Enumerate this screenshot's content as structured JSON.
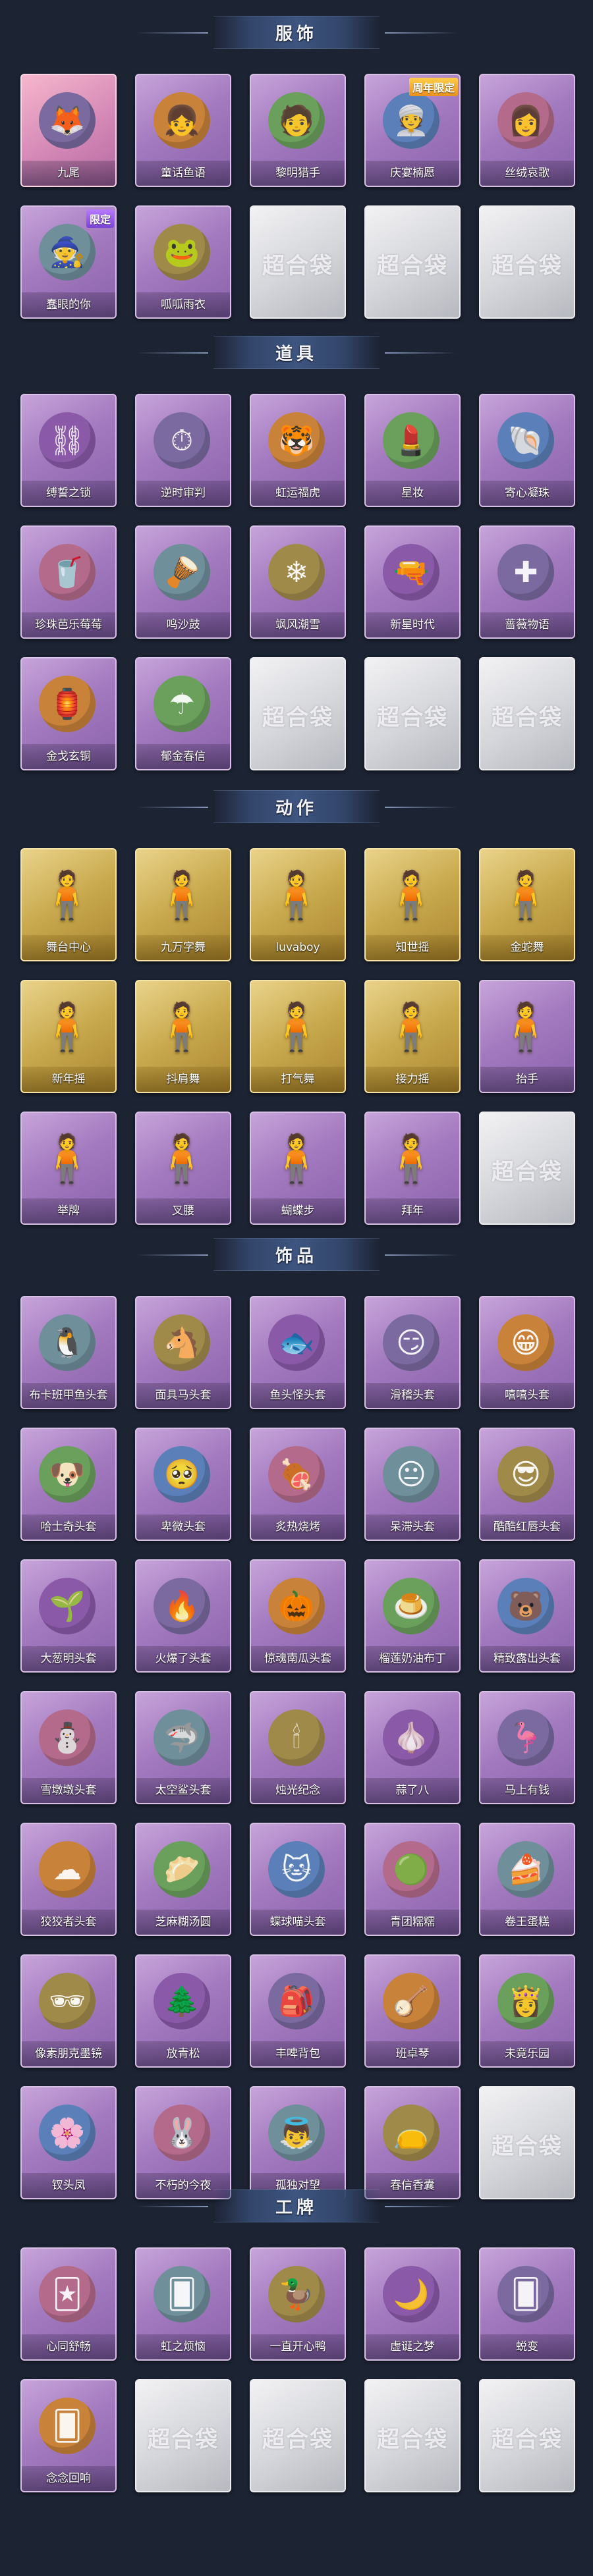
{
  "colors": {
    "background": "#1c2333",
    "banner": "#3d5580",
    "purple": "#a37abf",
    "gold": "#c8a84c",
    "empty": "#d4d5da"
  },
  "empty_watermark": "超合袋",
  "sections": [
    {
      "title": "服饰",
      "items": [
        {
          "label": "九尾",
          "rarity": "pink",
          "badge": "",
          "icon": "fox-costume-icon"
        },
        {
          "label": "童话鱼语",
          "rarity": "purple",
          "badge": "",
          "icon": "girl-portrait-icon"
        },
        {
          "label": "黎明猎手",
          "rarity": "purple",
          "badge": "",
          "icon": "hunter-portrait-icon"
        },
        {
          "label": "庆宴楠愿",
          "rarity": "purple",
          "badge": "周年限定",
          "icon": "party-portrait-icon"
        },
        {
          "label": "丝绒哀歌",
          "rarity": "purple",
          "badge": "",
          "icon": "velvet-portrait-icon"
        },
        {
          "label": "蠢眼的你",
          "rarity": "purple",
          "badge": "限定",
          "icon": "witch-portrait-icon"
        },
        {
          "label": "呱呱雨衣",
          "rarity": "purple",
          "badge": "",
          "icon": "frog-raincoat-icon"
        },
        {
          "label": "",
          "rarity": "empty",
          "badge": "",
          "icon": ""
        },
        {
          "label": "",
          "rarity": "empty",
          "badge": "",
          "icon": ""
        },
        {
          "label": "",
          "rarity": "empty",
          "badge": "",
          "icon": ""
        }
      ]
    },
    {
      "title": "道具",
      "items": [
        {
          "label": "缚誓之锁",
          "rarity": "purple",
          "badge": "",
          "icon": "chain-icon"
        },
        {
          "label": "逆时审判",
          "rarity": "purple",
          "badge": "",
          "icon": "clock-icon"
        },
        {
          "label": "虹运福虎",
          "rarity": "purple",
          "badge": "",
          "icon": "tiger-icon"
        },
        {
          "label": "星妆",
          "rarity": "purple",
          "badge": "",
          "icon": "cosmetic-icon"
        },
        {
          "label": "寄心凝珠",
          "rarity": "purple",
          "badge": "",
          "icon": "pearl-icon"
        },
        {
          "label": "珍珠芭乐莓莓",
          "rarity": "purple",
          "badge": "",
          "icon": "drink-icon"
        },
        {
          "label": "鸣沙鼓",
          "rarity": "purple",
          "badge": "",
          "icon": "drum-icon"
        },
        {
          "label": "飒风潮雪",
          "rarity": "purple",
          "badge": "",
          "icon": "ice-icon"
        },
        {
          "label": "新星时代",
          "rarity": "purple",
          "badge": "",
          "icon": "pistol-icon"
        },
        {
          "label": "蔷薇物语",
          "rarity": "purple",
          "badge": "",
          "icon": "medkit-icon"
        },
        {
          "label": "金戈玄铜",
          "rarity": "purple",
          "badge": "",
          "icon": "lantern-icon"
        },
        {
          "label": "郁金春信",
          "rarity": "purple",
          "badge": "",
          "icon": "umbrella-icon"
        },
        {
          "label": "",
          "rarity": "empty",
          "badge": "",
          "icon": ""
        },
        {
          "label": "",
          "rarity": "empty",
          "badge": "",
          "icon": ""
        },
        {
          "label": "",
          "rarity": "empty",
          "badge": "",
          "icon": ""
        }
      ]
    },
    {
      "title": "动作",
      "items": [
        {
          "label": "舞台中心",
          "rarity": "gold",
          "badge": "",
          "icon": "pose-icon"
        },
        {
          "label": "九万字舞",
          "rarity": "gold",
          "badge": "",
          "icon": "pose-icon"
        },
        {
          "label": "luvaboy",
          "rarity": "gold",
          "badge": "",
          "icon": "pose-icon"
        },
        {
          "label": "知世摇",
          "rarity": "gold",
          "badge": "",
          "icon": "pose-icon"
        },
        {
          "label": "金蛇舞",
          "rarity": "gold",
          "badge": "",
          "icon": "pose-icon"
        },
        {
          "label": "新年摇",
          "rarity": "gold",
          "badge": "",
          "icon": "pose-icon"
        },
        {
          "label": "抖肩舞",
          "rarity": "gold",
          "badge": "",
          "icon": "pose-icon"
        },
        {
          "label": "打气舞",
          "rarity": "gold",
          "badge": "",
          "icon": "pose-icon"
        },
        {
          "label": "接力摇",
          "rarity": "gold",
          "badge": "",
          "icon": "pose-icon"
        },
        {
          "label": "抬手",
          "rarity": "purple",
          "badge": "",
          "icon": "pose-icon"
        },
        {
          "label": "举牌",
          "rarity": "purple",
          "badge": "",
          "icon": "pose-icon"
        },
        {
          "label": "叉腰",
          "rarity": "purple",
          "badge": "",
          "icon": "pose-icon"
        },
        {
          "label": "蝴蝶步",
          "rarity": "purple",
          "badge": "",
          "icon": "pose-icon"
        },
        {
          "label": "拜年",
          "rarity": "purple",
          "badge": "",
          "icon": "pose-icon"
        },
        {
          "label": "",
          "rarity": "empty",
          "badge": "",
          "icon": ""
        }
      ]
    },
    {
      "title": "饰品",
      "items": [
        {
          "label": "布卡班甲鱼头套",
          "rarity": "purple",
          "badge": "",
          "icon": "seal-head-icon"
        },
        {
          "label": "面具马头套",
          "rarity": "purple",
          "badge": "",
          "icon": "horse-head-icon"
        },
        {
          "label": "鱼头怪头套",
          "rarity": "purple",
          "badge": "",
          "icon": "fish-head-icon"
        },
        {
          "label": "滑稽头套",
          "rarity": "purple",
          "badge": "",
          "icon": "smirk-head-icon"
        },
        {
          "label": "嘻嘻头套",
          "rarity": "purple",
          "badge": "",
          "icon": "grin-head-icon"
        },
        {
          "label": "哈士奇头套",
          "rarity": "purple",
          "badge": "",
          "icon": "dog-head-icon"
        },
        {
          "label": "卑微头套",
          "rarity": "purple",
          "badge": "",
          "icon": "sad-head-icon"
        },
        {
          "label": "炙热烧烤",
          "rarity": "purple",
          "badge": "",
          "icon": "bbq-head-icon"
        },
        {
          "label": "呆滞头套",
          "rarity": "purple",
          "badge": "",
          "icon": "dull-head-icon"
        },
        {
          "label": "酷酷红唇头套",
          "rarity": "purple",
          "badge": "",
          "icon": "cool-head-icon"
        },
        {
          "label": "大葱明头套",
          "rarity": "purple",
          "badge": "",
          "icon": "scallion-head-icon"
        },
        {
          "label": "火爆了头套",
          "rarity": "purple",
          "badge": "",
          "icon": "fire-head-icon"
        },
        {
          "label": "惊魂南瓜头套",
          "rarity": "purple",
          "badge": "",
          "icon": "pumpkin-head-icon"
        },
        {
          "label": "榴莲奶油布丁",
          "rarity": "purple",
          "badge": "",
          "icon": "pudding-head-icon"
        },
        {
          "label": "精致露出头套",
          "rarity": "purple",
          "badge": "",
          "icon": "pink-bear-head-icon"
        },
        {
          "label": "雪墩墩头套",
          "rarity": "purple",
          "badge": "",
          "icon": "snowman-head-icon"
        },
        {
          "label": "太空鲨头套",
          "rarity": "purple",
          "badge": "",
          "icon": "shark-head-icon"
        },
        {
          "label": "烛光纪念",
          "rarity": "purple",
          "badge": "",
          "icon": "candle-head-icon"
        },
        {
          "label": "蒜了八",
          "rarity": "purple",
          "badge": "",
          "icon": "garlic-head-icon"
        },
        {
          "label": "马上有钱",
          "rarity": "purple",
          "badge": "",
          "icon": "flamingo-head-icon"
        },
        {
          "label": "狡狡者头套",
          "rarity": "purple",
          "badge": "",
          "icon": "cloud-head-icon"
        },
        {
          "label": "芝麻糊汤圆",
          "rarity": "purple",
          "badge": "",
          "icon": "dumpling-head-icon"
        },
        {
          "label": "蝶球喵头套",
          "rarity": "purple",
          "badge": "",
          "icon": "cat-head-icon"
        },
        {
          "label": "青团糯糯",
          "rarity": "purple",
          "badge": "",
          "icon": "green-dumpling-head-icon"
        },
        {
          "label": "卷王蛋糕",
          "rarity": "purple",
          "badge": "",
          "icon": "roll-cake-head-icon"
        },
        {
          "label": "像素朋克墨镜",
          "rarity": "purple",
          "badge": "",
          "icon": "pixel-glasses-icon"
        },
        {
          "label": "放青松",
          "rarity": "purple",
          "badge": "",
          "icon": "bonsai-icon"
        },
        {
          "label": "丰啤背包",
          "rarity": "purple",
          "badge": "",
          "icon": "backpack-icon"
        },
        {
          "label": "班卓琴",
          "rarity": "purple",
          "badge": "",
          "icon": "banjo-icon"
        },
        {
          "label": "未竟乐园",
          "rarity": "purple",
          "badge": "",
          "icon": "doll-icon"
        },
        {
          "label": "钗头凤",
          "rarity": "purple",
          "badge": "",
          "icon": "hairpin-icon"
        },
        {
          "label": "不朽的今夜",
          "rarity": "purple",
          "badge": "",
          "icon": "bunny-icon"
        },
        {
          "label": "孤独对望",
          "rarity": "purple",
          "badge": "",
          "icon": "doll-pendant-icon"
        },
        {
          "label": "春信香囊",
          "rarity": "purple",
          "badge": "",
          "icon": "sachet-icon"
        },
        {
          "label": "",
          "rarity": "empty",
          "badge": "",
          "icon": ""
        }
      ]
    },
    {
      "title": "工牌",
      "items": [
        {
          "label": "心同舒畅",
          "rarity": "purple",
          "badge": "",
          "icon": "gold-card-icon"
        },
        {
          "label": "虹之烦恼",
          "rarity": "purple",
          "badge": "",
          "icon": "card-icon"
        },
        {
          "label": "一直开心鸭",
          "rarity": "purple",
          "badge": "",
          "icon": "duck-card-icon"
        },
        {
          "label": "虚诞之梦",
          "rarity": "purple",
          "badge": "",
          "icon": "dream-card-icon"
        },
        {
          "label": "蜕变",
          "rarity": "purple",
          "badge": "",
          "icon": "card-icon"
        },
        {
          "label": "念念回响",
          "rarity": "purple",
          "badge": "",
          "icon": "card-icon"
        },
        {
          "label": "",
          "rarity": "empty",
          "badge": "",
          "icon": ""
        },
        {
          "label": "",
          "rarity": "empty",
          "badge": "",
          "icon": ""
        },
        {
          "label": "",
          "rarity": "empty",
          "badge": "",
          "icon": ""
        },
        {
          "label": "",
          "rarity": "empty",
          "badge": "",
          "icon": ""
        }
      ]
    }
  ]
}
